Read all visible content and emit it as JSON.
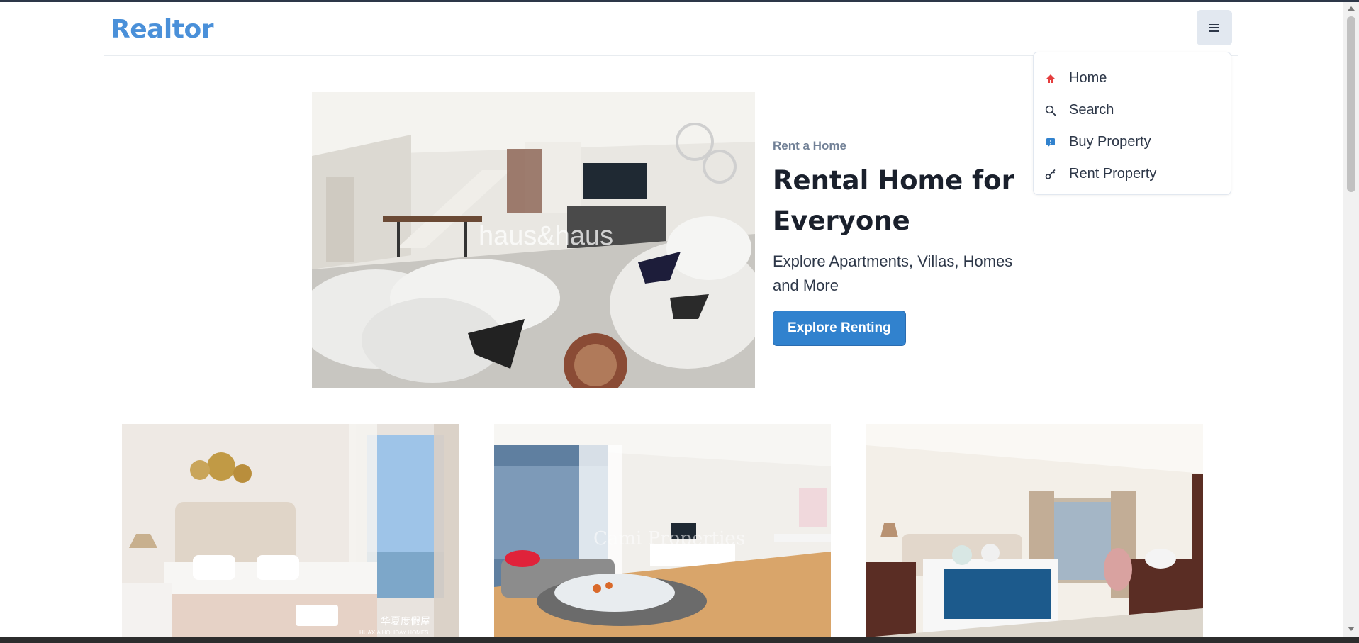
{
  "app": {
    "brand": "Realtor"
  },
  "header": {
    "menu_button_icon": "hamburger-icon"
  },
  "menu": {
    "items": [
      {
        "label": "Home",
        "icon": "home-icon"
      },
      {
        "label": "Search",
        "icon": "search-icon"
      },
      {
        "label": "Buy Property",
        "icon": "buy-property-icon"
      },
      {
        "label": "Rent Property",
        "icon": "key-icon"
      }
    ]
  },
  "hero": {
    "kicker": "Rent a Home",
    "title": "Rental Home for Everyone",
    "description": "Explore Apartments, Villas, Homes and More",
    "button_label": "Explore Renting",
    "image_watermark": "haus&haus"
  },
  "listings": [
    {
      "watermark_main": "华夏度假屋",
      "watermark_sub": "HUAXIA HOLIDAY HOMES"
    },
    {
      "watermark_main": "Cami Properties"
    },
    {
      "watermark_main": ""
    }
  ],
  "colors": {
    "brand": "#4a90d9",
    "primary_button": "#3182ce",
    "menu_button_bg": "#e2e8f0"
  }
}
